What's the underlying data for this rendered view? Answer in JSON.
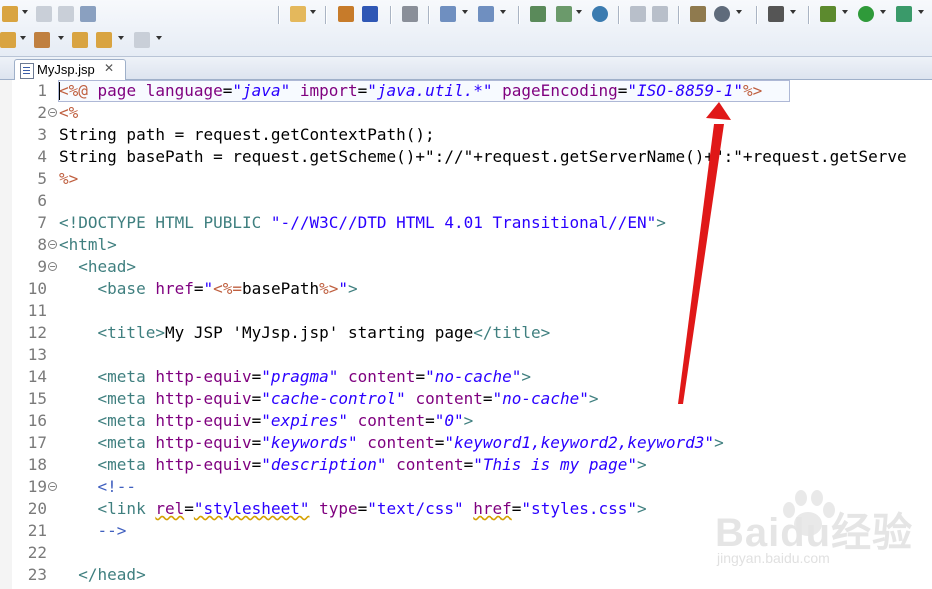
{
  "tab": {
    "label": "MyJsp.jsp",
    "close": "✕"
  },
  "editor": {
    "lines": [
      {
        "n": "1",
        "fold": ""
      },
      {
        "n": "2",
        "fold": "−"
      },
      {
        "n": "3",
        "fold": ""
      },
      {
        "n": "4",
        "fold": ""
      },
      {
        "n": "5",
        "fold": ""
      },
      {
        "n": "6",
        "fold": ""
      },
      {
        "n": "7",
        "fold": ""
      },
      {
        "n": "8",
        "fold": "−"
      },
      {
        "n": "9",
        "fold": "−"
      },
      {
        "n": "10",
        "fold": ""
      },
      {
        "n": "11",
        "fold": ""
      },
      {
        "n": "12",
        "fold": ""
      },
      {
        "n": "13",
        "fold": ""
      },
      {
        "n": "14",
        "fold": ""
      },
      {
        "n": "15",
        "fold": ""
      },
      {
        "n": "16",
        "fold": ""
      },
      {
        "n": "17",
        "fold": ""
      },
      {
        "n": "18",
        "fold": ""
      },
      {
        "n": "19",
        "fold": "−"
      },
      {
        "n": "20",
        "fold": ""
      },
      {
        "n": "21",
        "fold": ""
      },
      {
        "n": "22",
        "fold": ""
      },
      {
        "n": "23",
        "fold": ""
      }
    ],
    "code": {
      "l1": {
        "open": "<%@",
        "kw": " page ",
        "a1": "language",
        "eq": "=",
        "v1": "\"java\"",
        "a2": " import",
        "v2": "\"java.util.*\"",
        "a3": " pageEncoding",
        "v3": "\"ISO-8859-1\"",
        "close": "%>"
      },
      "l2": "<%",
      "l3": "String path = request.getContextPath();",
      "l4": "String basePath = request.getScheme()+\"://\"+request.getServerName()+\":\"+request.getServe",
      "l5": "%>",
      "l7": {
        "tag": "<!DOCTYPE HTML PUBLIC ",
        "val": "\"-//W3C//DTD HTML 4.01 Transitional//EN\"",
        "end": ">"
      },
      "l8": "<html>",
      "l9": "<head>",
      "l10": {
        "tag": "<base ",
        "attr": "href",
        "eq": "=",
        "q1": "\"",
        "dir": "<%=",
        "txt": "basePath",
        "dir2": "%>",
        "q2": "\"",
        "end": ">"
      },
      "l12": {
        "tag": "<title>",
        "txt": "My JSP 'MyJsp.jsp' starting page",
        "end": "</title>"
      },
      "l14": {
        "a": "http-equiv",
        "v": "\"pragma\"",
        "b": "content",
        "w": "\"no-cache\""
      },
      "l15": {
        "a": "http-equiv",
        "v": "\"cache-control\"",
        "b": "content",
        "w": "\"no-cache\""
      },
      "l16": {
        "a": "http-equiv",
        "v": "\"expires\"",
        "b": "content",
        "w": "\"0\""
      },
      "l17": {
        "a": "http-equiv",
        "v": "\"keywords\"",
        "b": "content",
        "w": "\"keyword1,keyword2,keyword3\""
      },
      "l18": {
        "a": "http-equiv",
        "v": "\"description\"",
        "b": "content",
        "w": "\"This is my page\""
      },
      "l19": "<!--",
      "l20": {
        "tag": "<link ",
        "a1": "rel",
        "v1": "\"stylesheet\"",
        "a2": "type",
        "v2": "\"text/css\"",
        "a3": "href",
        "v3": "\"styles.css\"",
        "end": ">"
      },
      "l21": "-->",
      "l23": "</head>"
    }
  },
  "watermark": {
    "logo": "Baidu经验",
    "sub": "jingyan.baidu.com"
  },
  "colors": {
    "tag": "#3f7f7f",
    "attr": "#7f007f",
    "value": "#2a00ff",
    "directive": "#bf5f3f",
    "comment": "#3f5fbf",
    "arrow": "#e01818"
  }
}
